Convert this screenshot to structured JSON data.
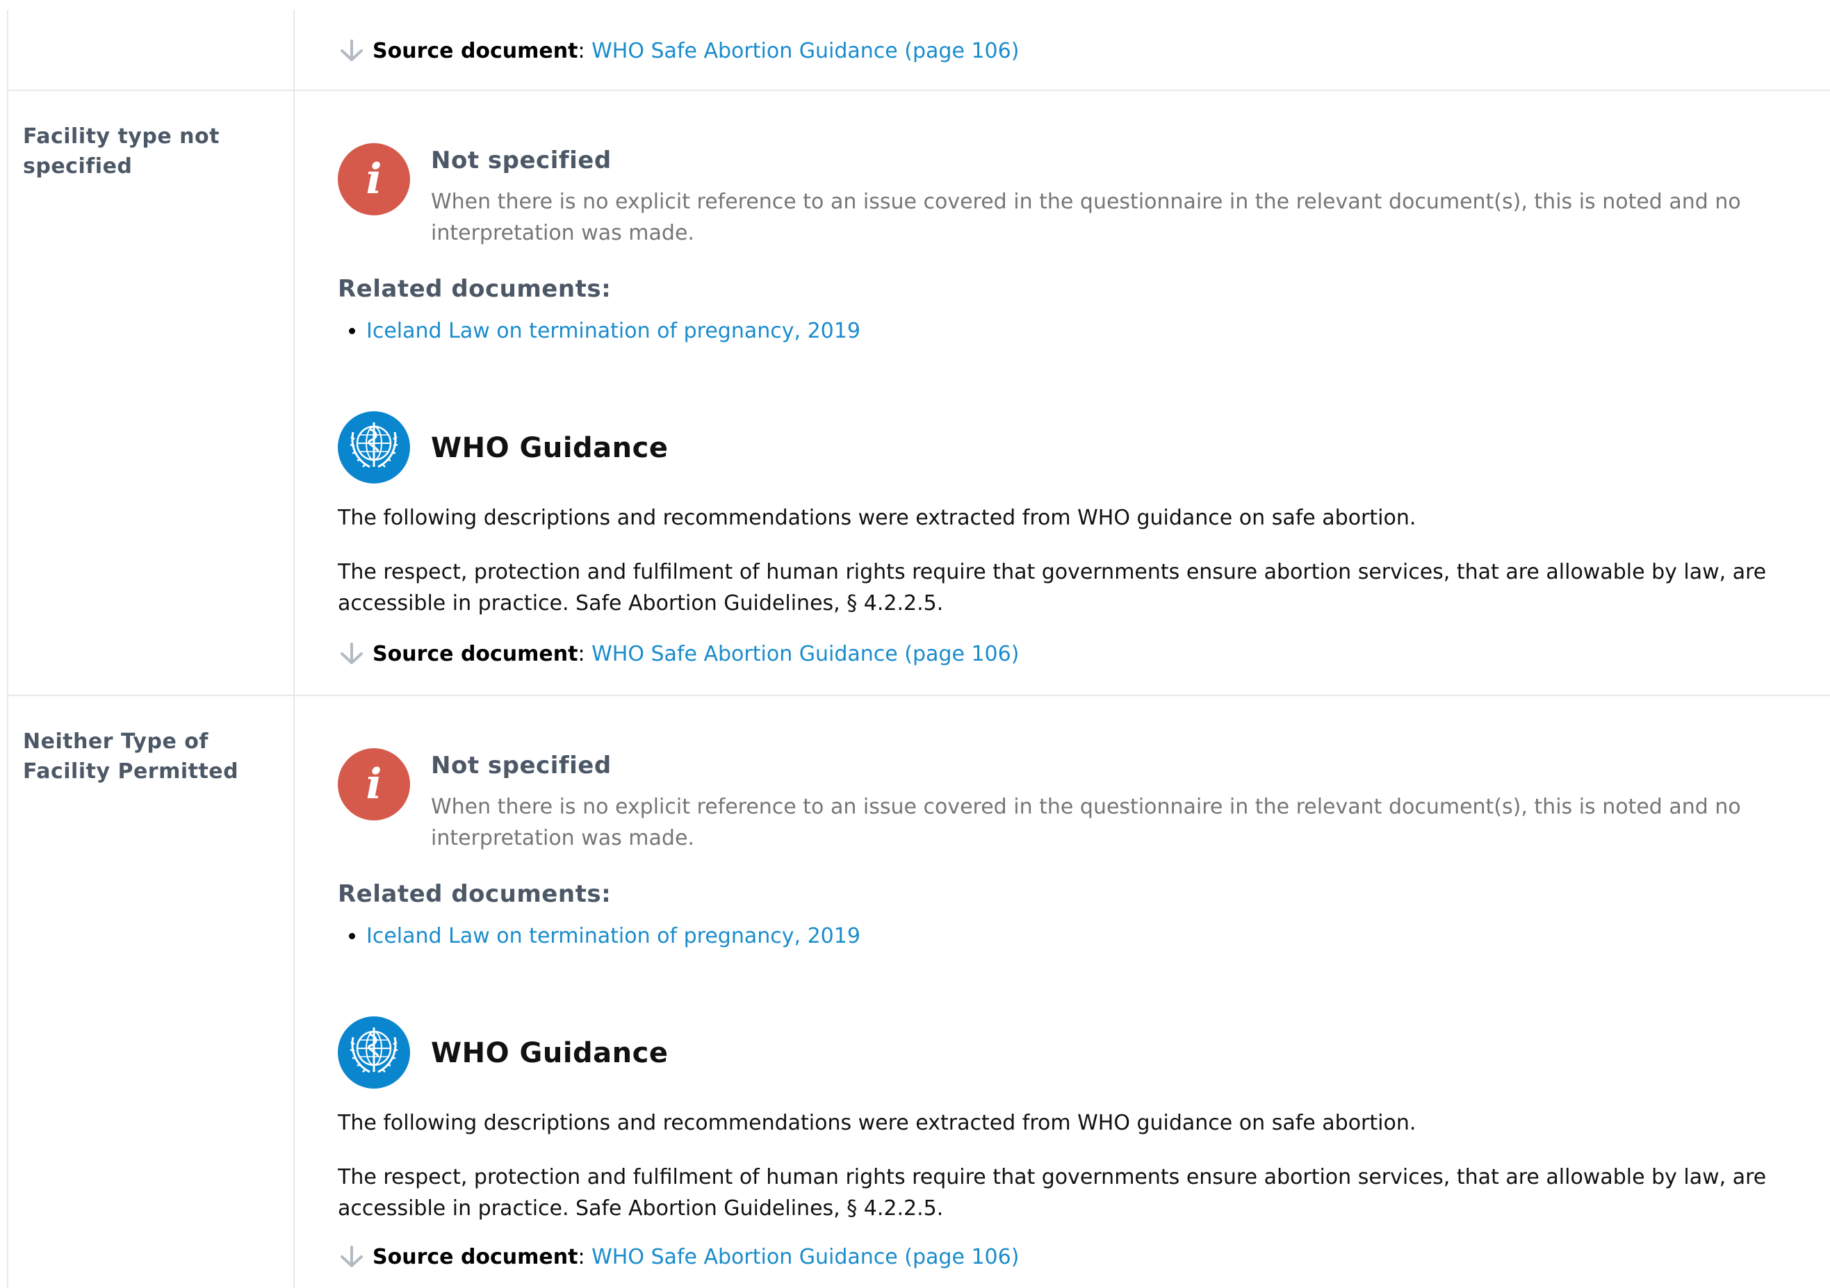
{
  "top": {
    "source_label": "Source document",
    "source_sep": ": ",
    "source_link": "WHO Safe Abortion Guidance (page 106)"
  },
  "rows": [
    {
      "label": "Facility type not specified",
      "status": {
        "icon": "info-icon",
        "title": "Not specified",
        "description": "When there is no explicit reference to an issue covered in the questionnaire in the relevant document(s), this is noted and no interpretation was made."
      },
      "related_title": "Related documents:",
      "related_docs": [
        "Iceland Law on termination of pregnancy, 2019"
      ],
      "who": {
        "icon": "who-emblem-icon",
        "title": "WHO Guidance",
        "intro": "The following descriptions and recommendations were extracted from WHO guidance on safe abortion.",
        "text": "The respect, protection and fulfilment of human rights require that governments ensure abortion services, that are allowable by law, are accessible in practice. Safe Abortion Guidelines, § 4.2.2.5."
      },
      "source_label": "Source document",
      "source_sep": ": ",
      "source_link": "WHO Safe Abortion Guidance (page 106)"
    },
    {
      "label": "Neither Type of Facility Permitted",
      "status": {
        "icon": "info-icon",
        "title": "Not specified",
        "description": "When there is no explicit reference to an issue covered in the questionnaire in the relevant document(s), this is noted and no interpretation was made."
      },
      "related_title": "Related documents:",
      "related_docs": [
        "Iceland Law on termination of pregnancy, 2019"
      ],
      "who": {
        "icon": "who-emblem-icon",
        "title": "WHO Guidance",
        "intro": "The following descriptions and recommendations were extracted from WHO guidance on safe abortion.",
        "text": "The respect, protection and fulfilment of human rights require that governments ensure abortion services, that are allowable by law, are accessible in practice. Safe Abortion Guidelines, § 4.2.2.5."
      },
      "source_label": "Source document",
      "source_sep": ": ",
      "source_link": "WHO Safe Abortion Guidance (page 106)"
    }
  ],
  "colors": {
    "link": "#1a8ccc",
    "info_icon_bg": "#d55a4c",
    "who_icon_bg": "#0a86cf",
    "label_text": "#4d5867",
    "muted_text": "#767676",
    "divider": "#e6e8ea"
  }
}
